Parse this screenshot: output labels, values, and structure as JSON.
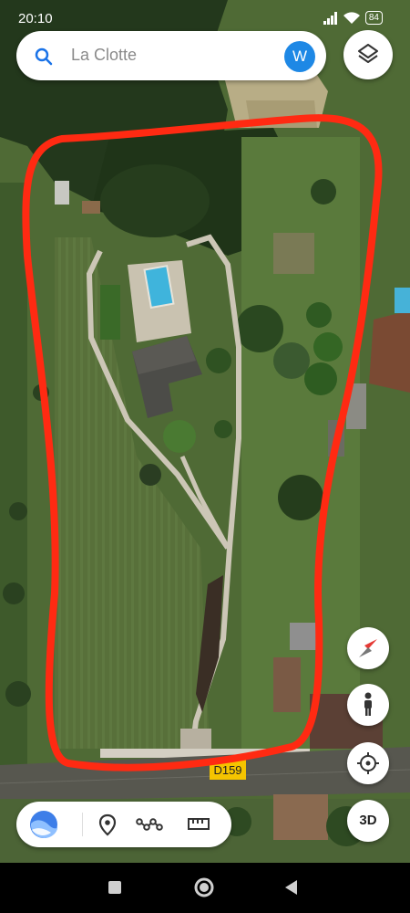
{
  "status_bar": {
    "time": "20:10",
    "battery": "84"
  },
  "search": {
    "placeholder": "La Clotte",
    "avatar_letter": "W"
  },
  "map": {
    "road_label": "D159"
  },
  "controls": {
    "three_d_label": "3D"
  },
  "icons": {
    "search": "search-icon",
    "layers": "layers-icon",
    "compass": "compass-icon",
    "street_view": "street-view-icon",
    "my_location": "my-location-icon",
    "earth_logo": "earth-logo-icon",
    "placemark": "placemark-icon",
    "path": "path-icon",
    "measure": "ruler-icon",
    "nav_recents": "recents-icon",
    "nav_home": "home-icon",
    "nav_back": "back-icon"
  },
  "colors": {
    "annotation": "#ff2a12",
    "road_sign": "#f5c400",
    "avatar": "#1e88e5"
  }
}
